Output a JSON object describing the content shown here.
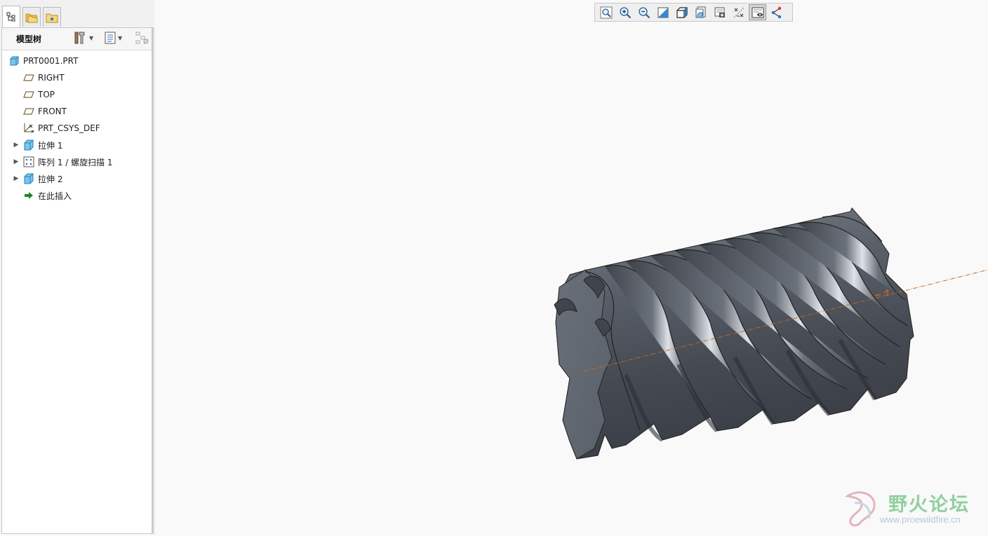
{
  "panel": {
    "tabs": [
      {
        "icon": "model-tree-tab-icon",
        "active": true
      },
      {
        "icon": "folder-browser-tab-icon",
        "active": false
      },
      {
        "icon": "favorites-tab-icon",
        "active": false
      }
    ],
    "title": "模型树",
    "header_buttons": [
      "settings-icon",
      "show-icon",
      "filter-icon"
    ]
  },
  "tree": {
    "root": {
      "label": "PRT0001.PRT",
      "icon": "part-icon"
    },
    "items": [
      {
        "label": "RIGHT",
        "icon": "datum-plane-icon",
        "expandable": false
      },
      {
        "label": "TOP",
        "icon": "datum-plane-icon",
        "expandable": false
      },
      {
        "label": "FRONT",
        "icon": "datum-plane-icon",
        "expandable": false
      },
      {
        "label": "PRT_CSYS_DEF",
        "icon": "csys-icon",
        "expandable": false
      },
      {
        "label": "拉伸 1",
        "icon": "extrude-icon",
        "expandable": true
      },
      {
        "label": "阵列 1 / 螺旋扫描 1",
        "icon": "pattern-icon",
        "expandable": true
      },
      {
        "label": "拉伸 2",
        "icon": "extrude-icon",
        "expandable": true
      },
      {
        "label": "在此插入",
        "icon": "insert-here-arrow-icon",
        "expandable": false
      }
    ]
  },
  "toolbar": {
    "buttons": [
      {
        "name": "refit-icon",
        "pressed": false
      },
      {
        "name": "zoom-in-icon",
        "pressed": false
      },
      {
        "name": "zoom-out-icon",
        "pressed": false
      },
      {
        "name": "repaint-icon",
        "pressed": false
      },
      {
        "name": "display-style-icon",
        "pressed": false
      },
      {
        "name": "saved-orientations-icon",
        "pressed": false
      },
      {
        "name": "view-manager-icon",
        "pressed": false
      },
      {
        "name": "datum-display-filters-icon",
        "pressed": false
      },
      {
        "name": "spin-center-icon",
        "pressed": true
      },
      {
        "name": "annotation-display-icon",
        "pressed": false
      }
    ]
  },
  "watermark": {
    "title": "野火论坛",
    "url": "www.proewildfire.cn"
  },
  "colors": {
    "model_body": "#525862",
    "model_highlight": "#d9dde3",
    "axis": "#c8651e",
    "tree_icon_blue": "#3aa0d8",
    "watermark_green": "#90d0a0"
  }
}
